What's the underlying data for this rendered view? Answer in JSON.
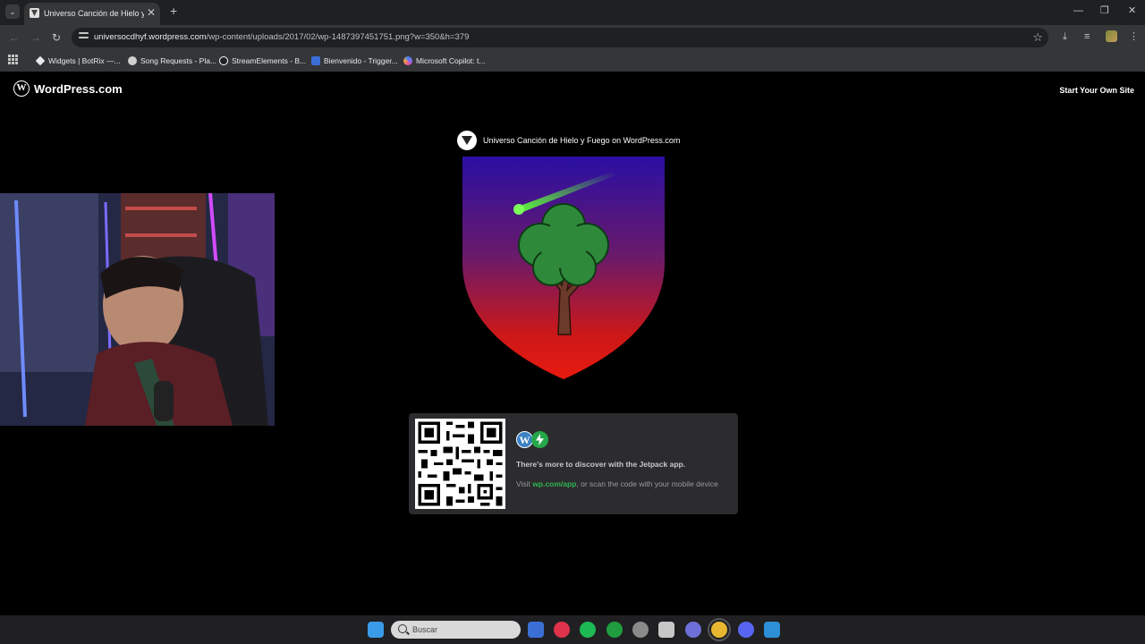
{
  "browser": {
    "tab_title": "Universo Canción de Hielo y Fuego",
    "tab_close": "✕",
    "new_tab": "+",
    "url_host": "universocdhyf.wordpress.com",
    "url_path": "/wp-content/uploads/2017/02/wp-1487397451751.png?w=350&h=379",
    "bookmarks": [
      {
        "label": "Widgets | BotRix —...",
        "icon": "diamond-icon",
        "color": "#e8eaed"
      },
      {
        "label": "Song Requests - Pla...",
        "icon": "headset-icon",
        "color": "#cfcfcf"
      },
      {
        "label": "StreamElements - B...",
        "icon": "streamelements-icon",
        "color": "#ffffff"
      },
      {
        "label": "Bienvenido - Trigger...",
        "icon": "trigger-icon",
        "color": "#3b6fd6"
      },
      {
        "label": "Microsoft Copilot: t...",
        "icon": "copilot-icon",
        "color": "#8c6cf0"
      }
    ]
  },
  "page": {
    "brand": "WordPress.com",
    "start_site": "Start Your Own Site",
    "site_credit": "Universo Canción de Hielo y Fuego on WordPress.com",
    "jetpack": {
      "headline": "There's more to discover with the Jetpack app.",
      "body_prefix": "Visit ",
      "link": "wp.com/app",
      "body_suffix": ", or scan the code with your mobile device"
    }
  },
  "taskbar": {
    "search_placeholder": "Buscar",
    "apps": [
      {
        "name": "windows-start-icon",
        "color": "#3a9be8"
      },
      {
        "name": "notes-app-icon",
        "color": "#3b6fd6"
      },
      {
        "name": "pinterest-icon",
        "color": "#e0324b"
      },
      {
        "name": "spotify-icon",
        "color": "#1db954"
      },
      {
        "name": "xbox-icon",
        "color": "#1f9d3f"
      },
      {
        "name": "clock-app-icon",
        "color": "#8a8a8a"
      },
      {
        "name": "editor-app-icon",
        "color": "#c7c7c7"
      },
      {
        "name": "gear-app-icon",
        "color": "#6f6fd8"
      },
      {
        "name": "chrome-icon",
        "color": "#e8b730"
      },
      {
        "name": "discord-icon",
        "color": "#5865f2"
      },
      {
        "name": "photos-app-icon",
        "color": "#2d8fd6"
      }
    ]
  }
}
